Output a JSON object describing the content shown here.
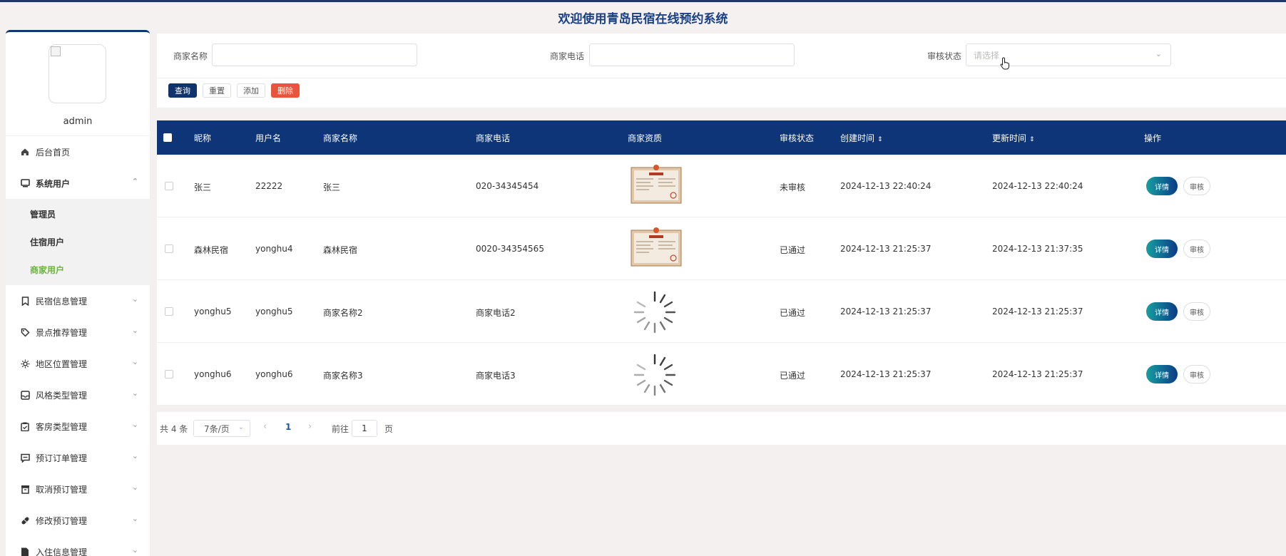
{
  "header": {
    "title": "欢迎使用青岛民宿在线预约系统"
  },
  "sidebar": {
    "username": "admin",
    "menu": [
      {
        "label": "后台首页",
        "icon": "home-icon"
      },
      {
        "label": "系统用户",
        "icon": "monitor-icon",
        "expanded": true,
        "children": [
          "管理员",
          "住宿用户",
          "商家用户"
        ],
        "active_child": "商家用户"
      },
      {
        "label": "民宿信息管理",
        "icon": "bookmark-icon"
      },
      {
        "label": "景点推荐管理",
        "icon": "tag-icon"
      },
      {
        "label": "地区位置管理",
        "icon": "sun-icon"
      },
      {
        "label": "风格类型管理",
        "icon": "inbox-icon"
      },
      {
        "label": "客房类型管理",
        "icon": "clipboard-check-icon"
      },
      {
        "label": "预订订单管理",
        "icon": "message-icon"
      },
      {
        "label": "取消预订管理",
        "icon": "archive-icon"
      },
      {
        "label": "修改预订管理",
        "icon": "pill-icon"
      },
      {
        "label": "入住信息管理",
        "icon": "document-icon"
      }
    ]
  },
  "search": {
    "merchant_name_label": "商家名称",
    "merchant_name_value": "",
    "merchant_phone_label": "商家电话",
    "merchant_phone_value": "",
    "audit_status_label": "审核状态",
    "audit_status_placeholder": "请选择",
    "buttons": {
      "query": "查询",
      "reset": "重置",
      "add": "添加",
      "delete": "删除"
    }
  },
  "table": {
    "headers": {
      "nickname": "昵称",
      "username": "用户名",
      "merchant_name": "商家名称",
      "merchant_phone": "商家电话",
      "qualification": "商家资质",
      "audit_status": "审核状态",
      "created_at": "创建时间",
      "updated_at": "更新时间",
      "actions": "操作"
    },
    "rows": [
      {
        "nickname": "张三",
        "username": "22222",
        "merchant_name": "张三",
        "merchant_phone": "020-34345454",
        "qualification": "license-image",
        "audit_status": "未审核",
        "created_at": "2024-12-13 22:40:24",
        "updated_at": "2024-12-13 22:40:24"
      },
      {
        "nickname": "森林民宿",
        "username": "yonghu4",
        "merchant_name": "森林民宿",
        "merchant_phone": "0020-34354565",
        "qualification": "license-image",
        "audit_status": "已通过",
        "created_at": "2024-12-13 21:25:37",
        "updated_at": "2024-12-13 21:37:35"
      },
      {
        "nickname": "yonghu5",
        "username": "yonghu5",
        "merchant_name": "商家名称2",
        "merchant_phone": "商家电话2",
        "qualification": "loading-spinner",
        "audit_status": "已通过",
        "created_at": "2024-12-13 21:25:37",
        "updated_at": "2024-12-13 21:25:37"
      },
      {
        "nickname": "yonghu6",
        "username": "yonghu6",
        "merchant_name": "商家名称3",
        "merchant_phone": "商家电话3",
        "qualification": "loading-spinner",
        "audit_status": "已通过",
        "created_at": "2024-12-13 21:25:37",
        "updated_at": "2024-12-13 21:25:37"
      }
    ],
    "row_actions": {
      "detail": "详情",
      "audit": "审核"
    }
  },
  "pagination": {
    "total": "共 4 条",
    "page_size": "7条/页",
    "current_page": "1",
    "goto_label": "前往",
    "goto_value": "1",
    "goto_suffix": "页"
  },
  "colors": {
    "header_blue": "#0e3577",
    "title_blue": "#1a3f84",
    "active_green": "#6db33f",
    "danger": "#e8553c"
  }
}
